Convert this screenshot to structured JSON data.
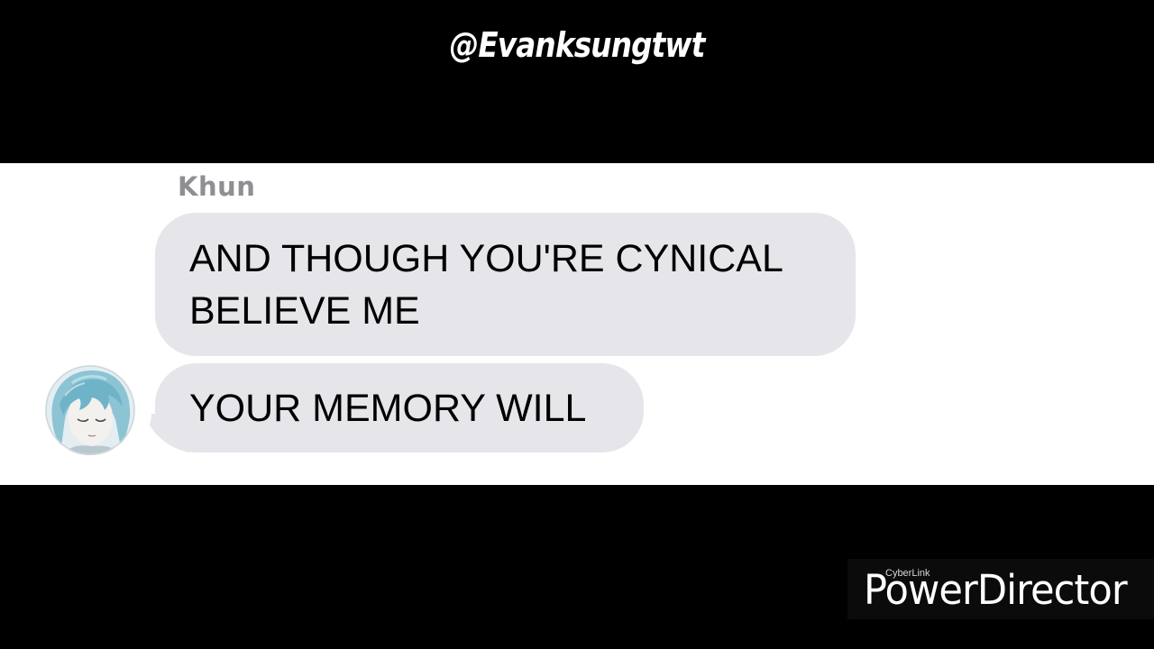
{
  "header": {
    "handle": "@Evanksungtwt"
  },
  "chat": {
    "sender_name": "Khun",
    "messages": [
      {
        "lines": [
          "AND THOUGH YOU'RE CYNICAL",
          "BELIEVE ME"
        ]
      },
      {
        "lines": [
          "YOUR MEMORY WILL"
        ]
      }
    ],
    "avatar_icon": "character-avatar-icon",
    "bubble_color": "#e5e5ea",
    "name_color": "#8e8e93"
  },
  "watermark": {
    "brand": "CyberLink",
    "product": "PowerDirector"
  }
}
